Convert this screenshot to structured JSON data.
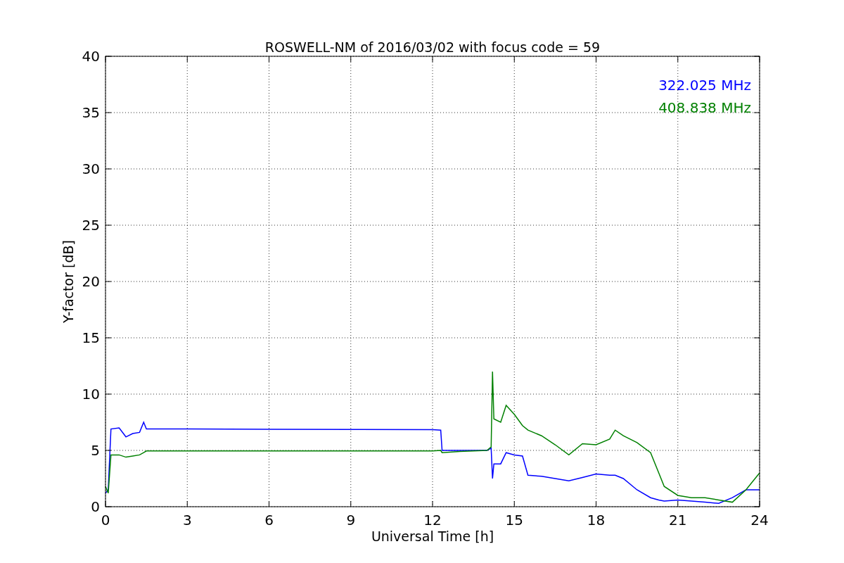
{
  "chart_data": {
    "type": "line",
    "title": "ROSWELL-NM of 2016/03/02 with focus code = 59",
    "xlabel": "Universal Time [h]",
    "ylabel": "Y-factor [dB]",
    "x": [
      0,
      0.1,
      0.2,
      0.5,
      0.75,
      1,
      1.25,
      1.4,
      1.5,
      3,
      6,
      9,
      12,
      12.3,
      12.35,
      13,
      14,
      14.15,
      14.2,
      14.25,
      14.5,
      14.7,
      15,
      15.3,
      15.5,
      16,
      16.5,
      17,
      17.5,
      18,
      18.5,
      18.7,
      19,
      19.5,
      20,
      20.3,
      20.5,
      21,
      21.5,
      22,
      22.5,
      23,
      23.5,
      24
    ],
    "series": [
      {
        "name": "322.025 MHz",
        "color": "#0000ff",
        "values": [
          1.2,
          1.5,
          6.9,
          7.0,
          6.2,
          6.5,
          6.6,
          7.5,
          6.9,
          6.9,
          6.88,
          6.86,
          6.85,
          6.8,
          5.0,
          5.0,
          5.0,
          5.2,
          2.5,
          3.8,
          3.8,
          4.8,
          4.6,
          4.5,
          2.8,
          2.7,
          2.5,
          2.3,
          2.6,
          2.9,
          2.8,
          2.8,
          2.5,
          1.5,
          0.8,
          0.6,
          0.5,
          0.6,
          0.5,
          0.4,
          0.3,
          0.8,
          1.5,
          1.5
        ]
      },
      {
        "name": "408.838 MHz",
        "color": "#008000",
        "values": [
          1.8,
          1.2,
          4.6,
          4.6,
          4.4,
          4.5,
          4.6,
          4.8,
          4.95,
          4.95,
          4.95,
          4.95,
          4.95,
          5.0,
          4.8,
          4.9,
          5.0,
          5.3,
          12.0,
          7.8,
          7.5,
          9.0,
          8.2,
          7.2,
          6.8,
          6.3,
          5.5,
          4.6,
          5.6,
          5.5,
          6.0,
          6.8,
          6.3,
          5.7,
          4.8,
          3.0,
          1.8,
          1.0,
          0.8,
          0.8,
          0.6,
          0.4,
          1.5,
          3.0
        ]
      }
    ],
    "grid": true,
    "xlim": [
      0,
      24
    ],
    "ylim": [
      0,
      40
    ],
    "xticks": [
      0,
      3,
      6,
      9,
      12,
      15,
      18,
      21,
      24
    ],
    "yticks": [
      0,
      5,
      10,
      15,
      20,
      25,
      30,
      35,
      40
    ]
  }
}
